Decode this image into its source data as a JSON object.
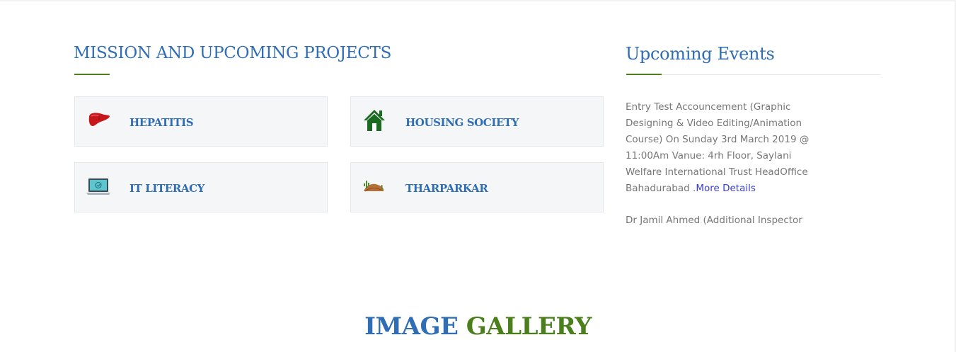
{
  "mission": {
    "title": "MISSION AND UPCOMING PROJECTS",
    "projects": [
      {
        "label": "HEPATITIS",
        "icon": "liver-icon"
      },
      {
        "label": "HOUSING SOCIETY",
        "icon": "house-icon"
      },
      {
        "label": "IT LITERACY",
        "icon": "laptop-icon"
      },
      {
        "label": "THARPARKAR",
        "icon": "desert-icon"
      }
    ]
  },
  "events": {
    "title": "Upcoming Events",
    "items": [
      {
        "text": "Entry Test Accouncement (Graphic Designing & Video Editing/Animation Course) On Sunday 3rd March 2019 @ 11:00Am Vanue: 4rh Floor, Saylani Welfare International Trust HeadOffice Bahadurabad .",
        "link": "More Details"
      },
      {
        "text": "Dr Jamil Ahmed (Additional Inspector",
        "link": ""
      }
    ]
  },
  "gallery": {
    "title_part1": "IMAGE",
    "title_part2": "GALLERY"
  },
  "colors": {
    "heading_blue": "#2f6db5",
    "accent_green": "#4a7f1b",
    "link_blue": "#3a3fd1"
  }
}
